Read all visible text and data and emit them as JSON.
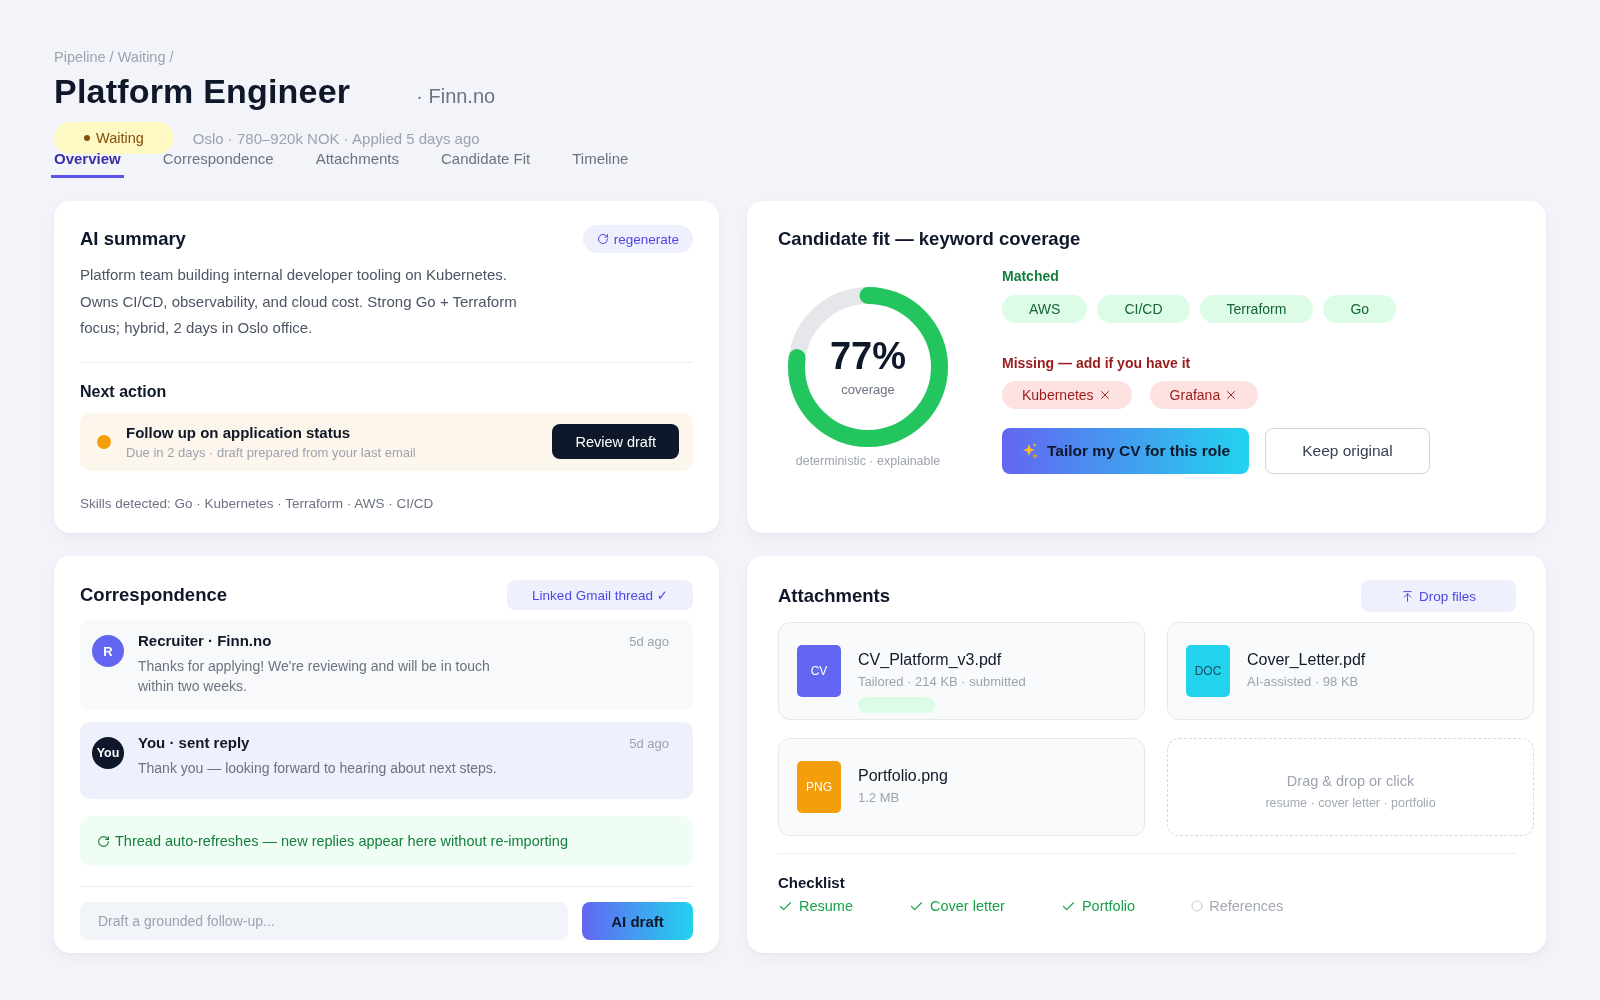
{
  "breadcrumb": "Pipeline / Waiting /",
  "title": "Platform Engineer",
  "company": "· Finn.no",
  "status": {
    "label": "Waiting",
    "kind": "waiting"
  },
  "meta": "Oslo · 780–920k NOK · Applied 5 days ago",
  "tabs": [
    {
      "label": "Overview",
      "selected": true
    },
    {
      "label": "Correspondence",
      "selected": false
    },
    {
      "label": "Attachments",
      "selected": false
    },
    {
      "label": "Candidate Fit",
      "selected": false
    },
    {
      "label": "Timeline",
      "selected": false
    }
  ],
  "ai_summary": {
    "title": "AI summary",
    "action": "regenerate",
    "text": "Platform team building internal developer tooling on Kubernetes. Owns CI/CD, observability, and cloud cost. Strong Go + Terraform focus; hybrid, 2 days in Oslo office.",
    "next_action": {
      "heading": "Next action",
      "title": "Follow up on application status",
      "subtitle": "Due in 2 days · draft prepared from your last email",
      "button": "Review draft"
    },
    "skills": "Skills detected: Go · Kubernetes · Terraform · AWS · CI/CD"
  },
  "candidate_fit": {
    "title": "Candidate fit — keyword coverage",
    "coverage": {
      "level": 0.77,
      "reading": "77%",
      "caption": "coverage",
      "note": "deterministic · explainable"
    },
    "matched": {
      "heading": "Matched",
      "keywords": [
        "AWS",
        "CI/CD",
        "Terraform",
        "Go"
      ]
    },
    "missing": {
      "heading": "Missing — add if you have it",
      "keywords": [
        "Kubernetes",
        "Grafana"
      ]
    },
    "buttons": [
      {
        "label": "Tailor my CV for this role",
        "kind": "primary"
      },
      {
        "label": "Keep original",
        "kind": "secondary"
      }
    ]
  },
  "correspondence": {
    "title": "Correspondence",
    "link": "Linked Gmail thread ✓",
    "messages": [
      {
        "kind": "received",
        "avatar": "R",
        "sender": "Recruiter · Finn.no",
        "time": "5d ago",
        "text": "Thanks for applying! We're reviewing and will be in touch within two weeks."
      },
      {
        "kind": "sent",
        "avatar": "You",
        "sender": "You · sent reply",
        "time": "5d ago",
        "text": "Thank you — looking forward to hearing about next steps."
      }
    ],
    "notice": "Thread auto-refreshes — new replies appear here without re-importing",
    "composer": {
      "placeholder": "Draft a grounded follow-up...",
      "button": "AI draft"
    }
  },
  "attachments": {
    "title": "Attachments",
    "action": "Drop files",
    "files": [
      {
        "type": "CV",
        "color": "#6366f1",
        "name": "CV_Platform_v3.pdf",
        "meta": "Tailored · 214 KB · submitted",
        "badge": true
      },
      {
        "type": "DOC",
        "color": "#22d3ee",
        "name": "Cover_Letter.pdf",
        "meta": "AI-assisted · 98 KB",
        "badge": false
      },
      {
        "type": "PNG",
        "color": "#f59e0b",
        "name": "Portfolio.png",
        "meta": "1.2 MB",
        "badge": false
      }
    ],
    "dropzone": {
      "title": "Drag & drop or click",
      "hint": "resume · cover letter · portfolio"
    },
    "checklist": {
      "title": "Checklist",
      "items": [
        {
          "label": "Resume",
          "checked": true
        },
        {
          "label": "Cover letter",
          "checked": true
        },
        {
          "label": "Portfolio",
          "checked": true
        },
        {
          "label": "References",
          "checked": false
        }
      ]
    }
  }
}
